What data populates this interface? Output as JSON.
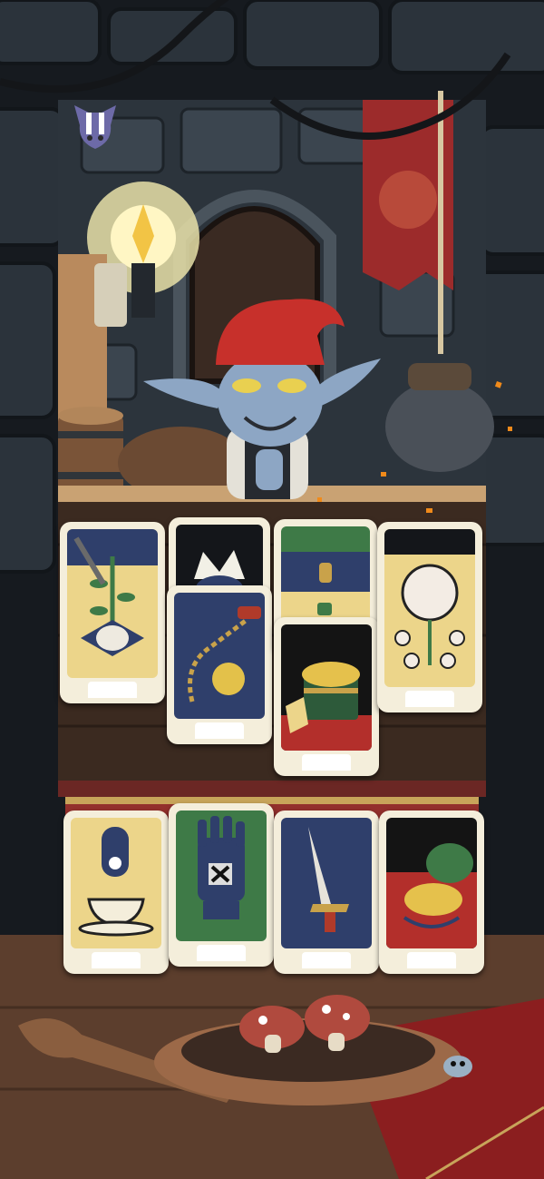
{
  "game": {
    "title": "",
    "accent_colors": {
      "stone": "#2a3138",
      "wood": "#4a3528",
      "red": "#9b2c2a",
      "cream": "#f0d78a",
      "navy": "#2f3f6b",
      "green": "#3e7a47"
    }
  },
  "hud": {
    "pause_icon": "pause-bat-icon"
  },
  "dealer": {
    "name_icon": "goblin-dealer-portrait",
    "hat_color": "#c7302b"
  },
  "board": {
    "top_rows": [
      {
        "id": "herb-card",
        "icon": "herb-with-dagger-icon",
        "theme": "cream"
      },
      {
        "id": "jester-card",
        "icon": "jester-hat-icon",
        "theme": "navy"
      },
      {
        "id": "flail-card",
        "icon": "flail-icon",
        "theme": "navy"
      },
      {
        "id": "potion-card",
        "icon": "potion-icon",
        "theme": "green"
      },
      {
        "id": "treasure-chest-card",
        "icon": "treasure-chest-icon",
        "theme": "red"
      },
      {
        "id": "rose-card",
        "icon": "rose-flower-icon",
        "theme": "cream"
      }
    ],
    "hand": [
      {
        "id": "teacup-card",
        "icon": "teacup-icon",
        "theme": "cream"
      },
      {
        "id": "gauntlet-card",
        "icon": "gauntlet-icon",
        "theme": "green"
      },
      {
        "id": "dagger-card",
        "icon": "dagger-icon",
        "theme": "navy"
      },
      {
        "id": "gold-sack-card",
        "icon": "gold-sack-icon",
        "theme": "red"
      }
    ]
  }
}
